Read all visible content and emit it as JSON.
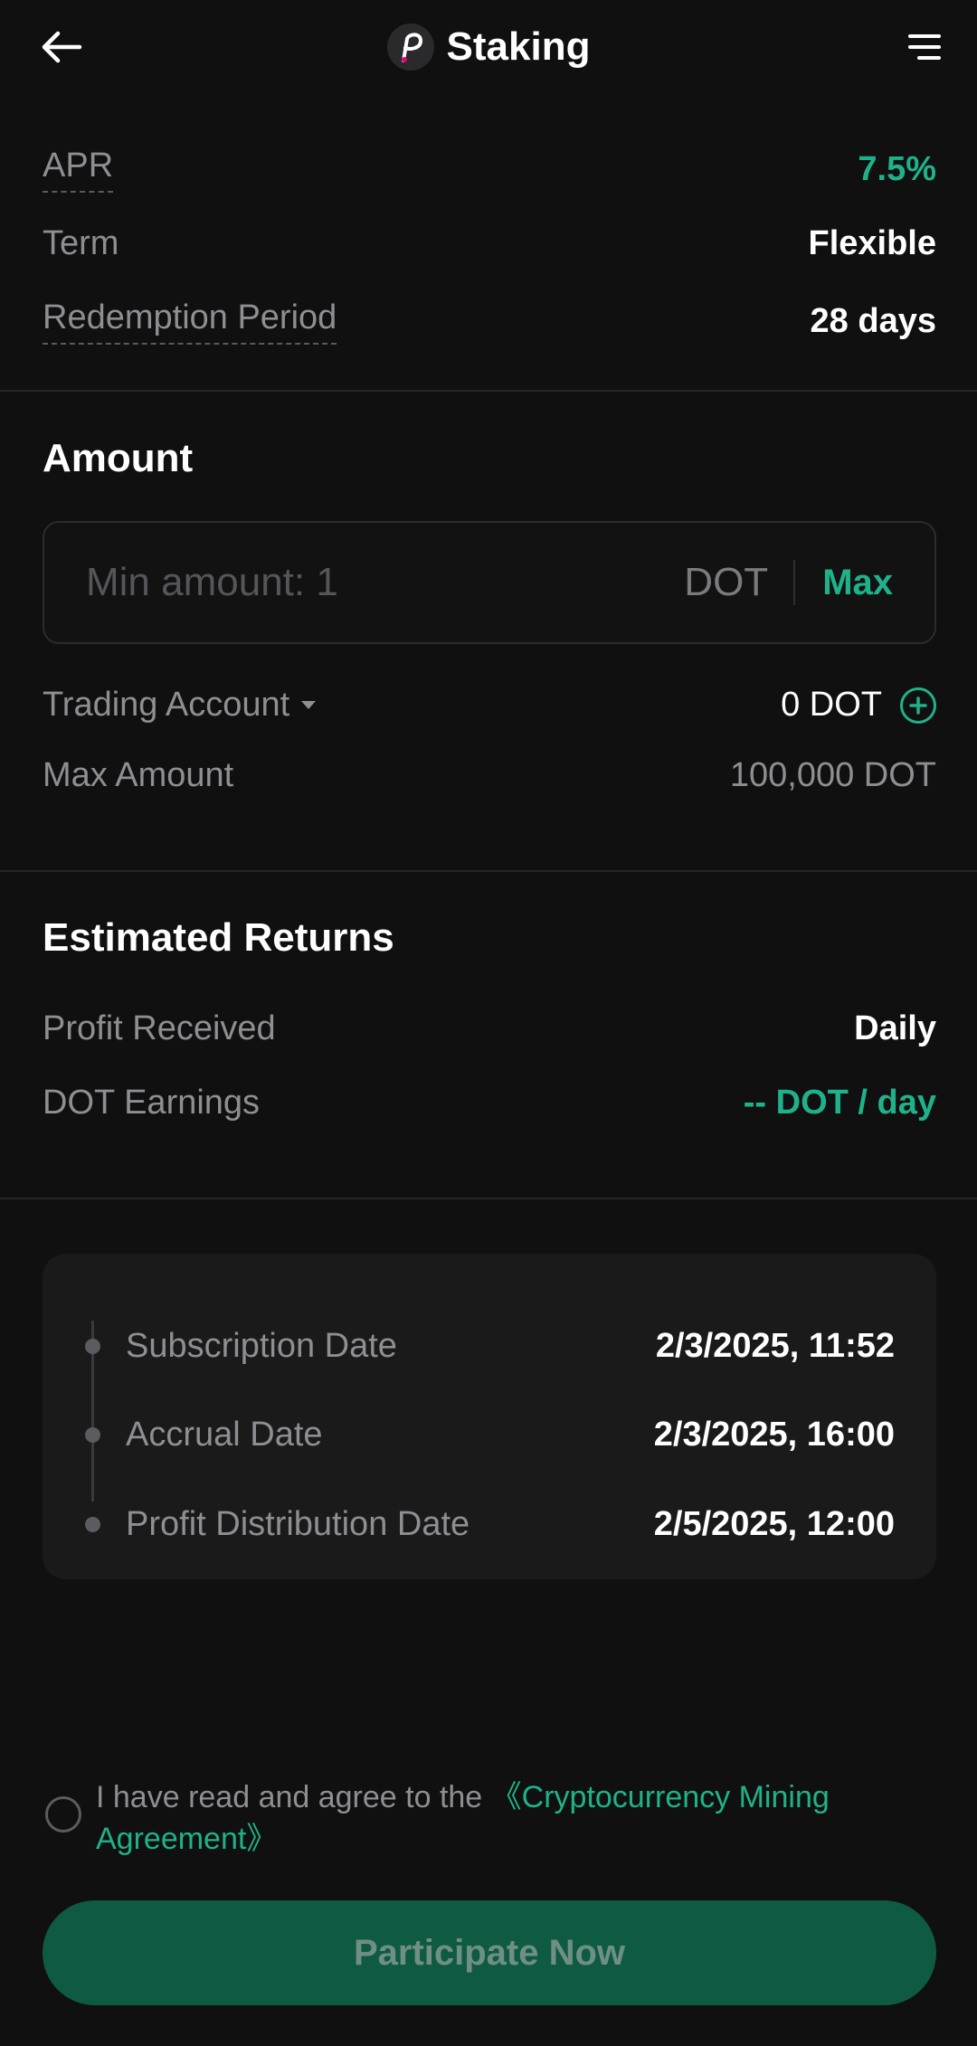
{
  "header": {
    "title": "Staking",
    "back_icon": "arrow-left-icon",
    "menu_icon": "menu-icon",
    "coin_icon": "polkadot-logo"
  },
  "summary": {
    "apr_label": "APR",
    "apr_value": "7.5%",
    "term_label": "Term",
    "term_value": "Flexible",
    "redemption_label": "Redemption Period",
    "redemption_value": "28 days"
  },
  "amount": {
    "section_title": "Amount",
    "input_placeholder": "Min amount: 1",
    "input_value": "",
    "unit": "DOT",
    "max_label": "Max",
    "account_label": "Trading Account",
    "account_balance": "0 DOT",
    "max_amount_label": "Max Amount",
    "max_amount_value": "100,000 DOT"
  },
  "returns": {
    "section_title": "Estimated Returns",
    "profit_received_label": "Profit Received",
    "profit_received_value": "Daily",
    "earnings_label": "DOT Earnings",
    "earnings_value": "-- DOT / day"
  },
  "timeline": [
    {
      "label": "Subscription Date",
      "value": "2/3/2025, 11:52"
    },
    {
      "label": "Accrual Date",
      "value": "2/3/2025, 16:00"
    },
    {
      "label": "Profit Distribution Date",
      "value": "2/5/2025, 12:00"
    }
  ],
  "agreement": {
    "prefix": "I have read and agree to the ",
    "link": "《Cryptocurrency Mining Agreement》",
    "checked": false
  },
  "cta_label": "Participate Now",
  "colors": {
    "accent_green": "#1fb28a",
    "cta_bg": "#0e5a43",
    "background": "#101010"
  }
}
